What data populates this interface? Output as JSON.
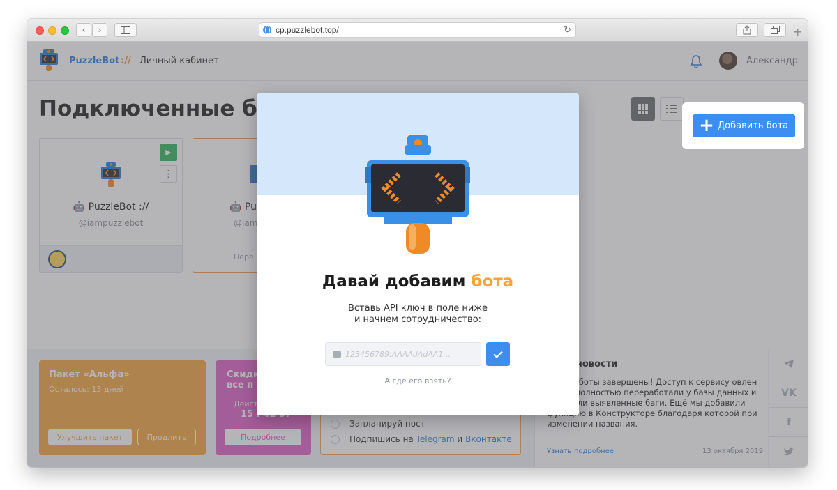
{
  "browser": {
    "url": "cp.puzzlebot.top/"
  },
  "header": {
    "brand": "PuzzleBot",
    "brand_sep": "://",
    "section": "Личный кабинет",
    "user_name": "Александр"
  },
  "main": {
    "title": "Подключенные бот",
    "add_bot_label": "Добавить бота"
  },
  "bot_cards": [
    {
      "name": "🤖 PuzzleBot ://",
      "handle": "@iampuzzlebot"
    },
    {
      "name": "🤖 Pu",
      "handle": "@iam",
      "footer": "Пере"
    }
  ],
  "promo": {
    "alpha_title": "Пакет «Альфа»",
    "alpha_sub": "Осталось: 13 дней",
    "upgrade_label": "Улучшить пакет",
    "extend_label": "Продлить",
    "sale_title": "Скидк\nвсе п",
    "sale_small": "Дейст",
    "sale_timer": "15 : 42 57",
    "sale_more": "Подробнее"
  },
  "checklist": {
    "item1": "Запланируй пост",
    "item2_prefix": "Подпишись на",
    "item2_link1": "Telegram",
    "item2_and": "и",
    "item2_link2": "Вконтакте"
  },
  "news": {
    "title": "дние новости",
    "text": "ские работы завершены! Доступ к сервису овлен ✅ Мы полностью переработали у базы данных и починили выявленные баги. Ещё мы добавили функцию в Конструкторе благодаря которой при изменении названия.",
    "more": "Узнать подробнее",
    "date": "13 октября 2019"
  },
  "social": [
    "telegram-icon",
    "vk-icon",
    "facebook-icon",
    "twitter-icon"
  ],
  "modal": {
    "heading_main": "Давай добавим",
    "heading_accent": "бота",
    "desc_line1": "Вставь API ключ в поле ниже",
    "desc_line2": "и начнем сотрудничество:",
    "input_placeholder": "123456789:AAAAdAdAA1...",
    "where_link": "А где его взять?"
  },
  "colors": {
    "accent_blue": "#3d8ef0",
    "accent_orange": "#f5a43c",
    "promo_pink": "#de5fc6"
  }
}
